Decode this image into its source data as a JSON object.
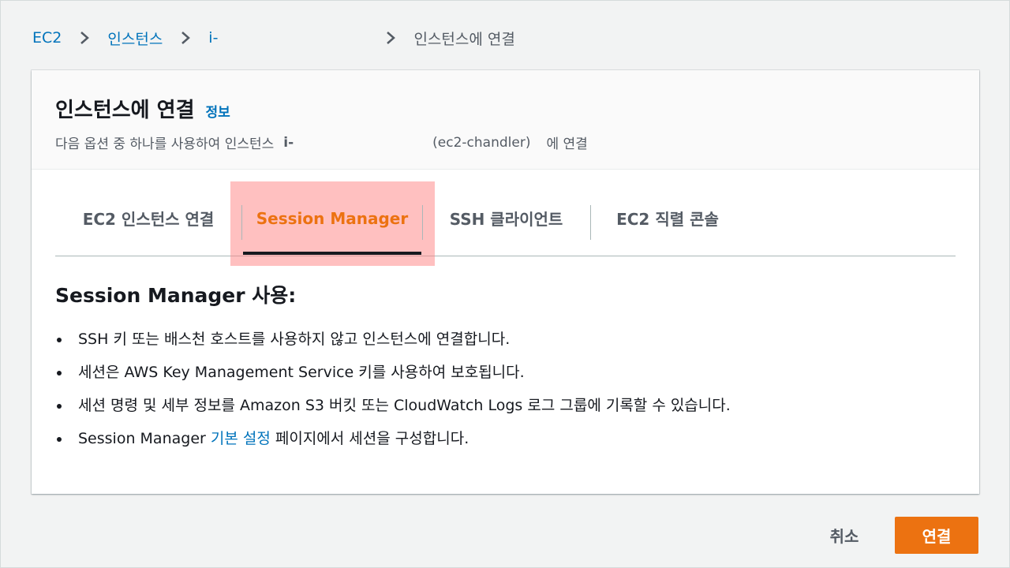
{
  "breadcrumb": {
    "items": [
      "EC2",
      "인스턴스",
      "i-"
    ],
    "current": "인스턴스에 연결"
  },
  "panel": {
    "title": "인스턴스에 연결",
    "info_link": "정보",
    "description": {
      "prefix": "다음 옵션 중 하나를 사용하여 인스턴스",
      "instance_id": "i-",
      "instance_name": "(ec2-chandler)",
      "suffix": "에 연결"
    }
  },
  "tabs": [
    {
      "label": "EC2 인스턴스 연결",
      "active": false
    },
    {
      "label": "Session Manager",
      "active": true
    },
    {
      "label": "SSH 클라이언트",
      "active": false
    },
    {
      "label": "EC2 직렬 콘솔",
      "active": false
    }
  ],
  "content": {
    "title": "Session Manager 사용:",
    "bullets": [
      "SSH 키 또는 배스천 호스트를 사용하지 않고 인스턴스에 연결합니다.",
      "세션은 AWS Key Management Service 키를 사용하여 보호됩니다.",
      "세션 명령 및 세부 정보를 Amazon S3 버킷 또는 CloudWatch Logs 로그 그룹에 기록할 수 있습니다."
    ],
    "last_bullet": {
      "prefix": "Session Manager ",
      "link": "기본 설정",
      "suffix": " 페이지에서 세션을 구성합니다."
    }
  },
  "footer": {
    "cancel_label": "취소",
    "connect_label": "연결"
  },
  "colors": {
    "link": "#0073bb",
    "accent": "#ec7211",
    "text": "#16191f",
    "muted": "#545b64"
  }
}
